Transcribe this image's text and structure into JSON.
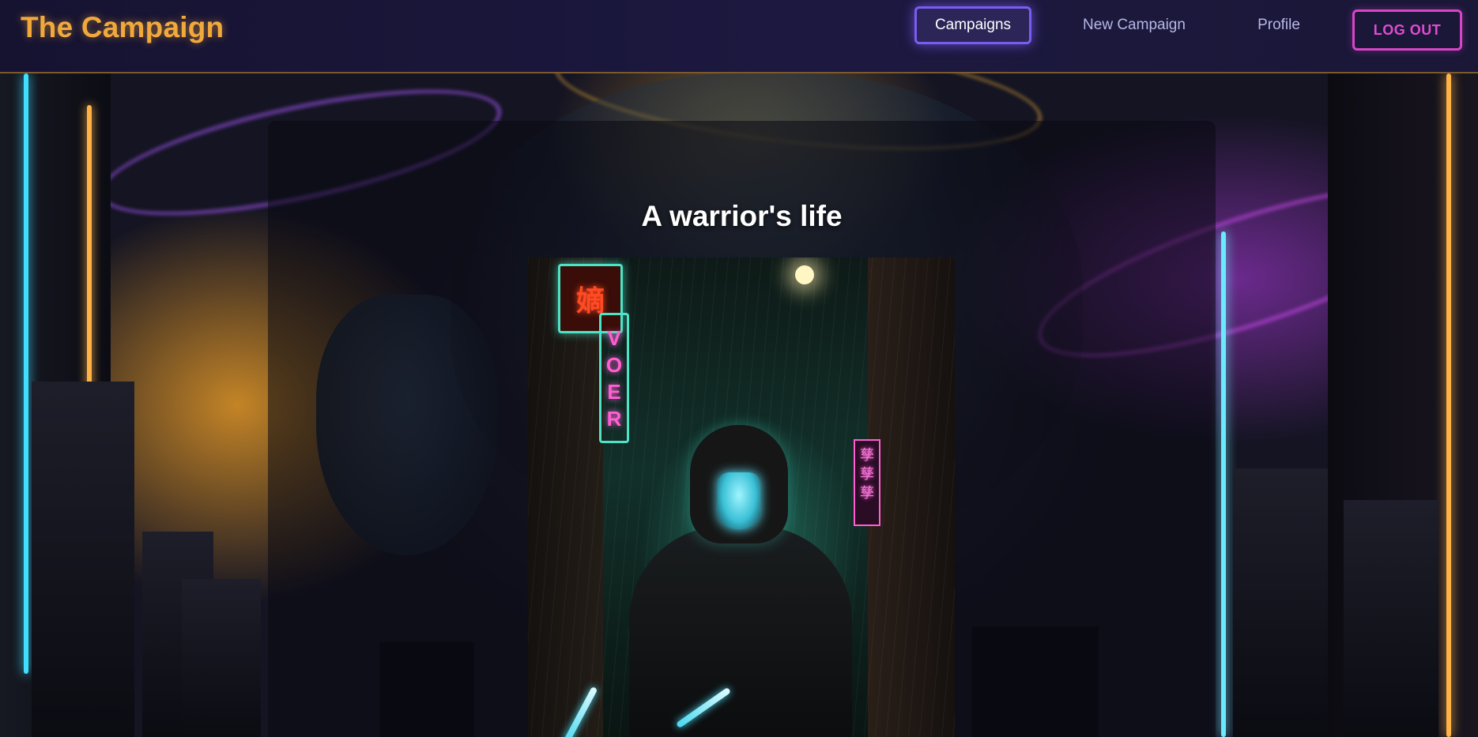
{
  "brand": {
    "title": "The Campaign"
  },
  "nav": {
    "campaigns": "Campaigns",
    "new_campaign": "New Campaign",
    "profile": "Profile",
    "logout": "LOG OUT",
    "active": "Campaigns"
  },
  "campaign": {
    "title": "A warrior's life",
    "art_sign_text": "VOER"
  },
  "colors": {
    "brand": "#f2a93c",
    "active_nav_border": "#7b5cf0",
    "logout": "#d845c6",
    "header_bg": "#1c1840"
  }
}
